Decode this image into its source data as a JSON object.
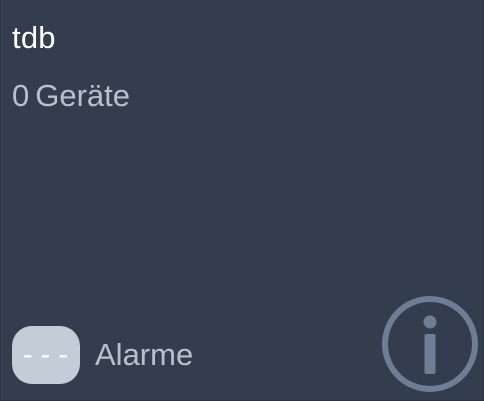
{
  "tile": {
    "title": "tdb",
    "device_count": "0",
    "device_label": "Geräte",
    "alarm_badge": "---",
    "alarm_label": "Alarme",
    "info_icon": "info-circle-icon"
  },
  "colors": {
    "background": "#333d4e",
    "title": "#ffffff",
    "muted_text": "#b7c0cd",
    "badge_bg": "#c3ccd7",
    "icon": "#6e7d93"
  }
}
